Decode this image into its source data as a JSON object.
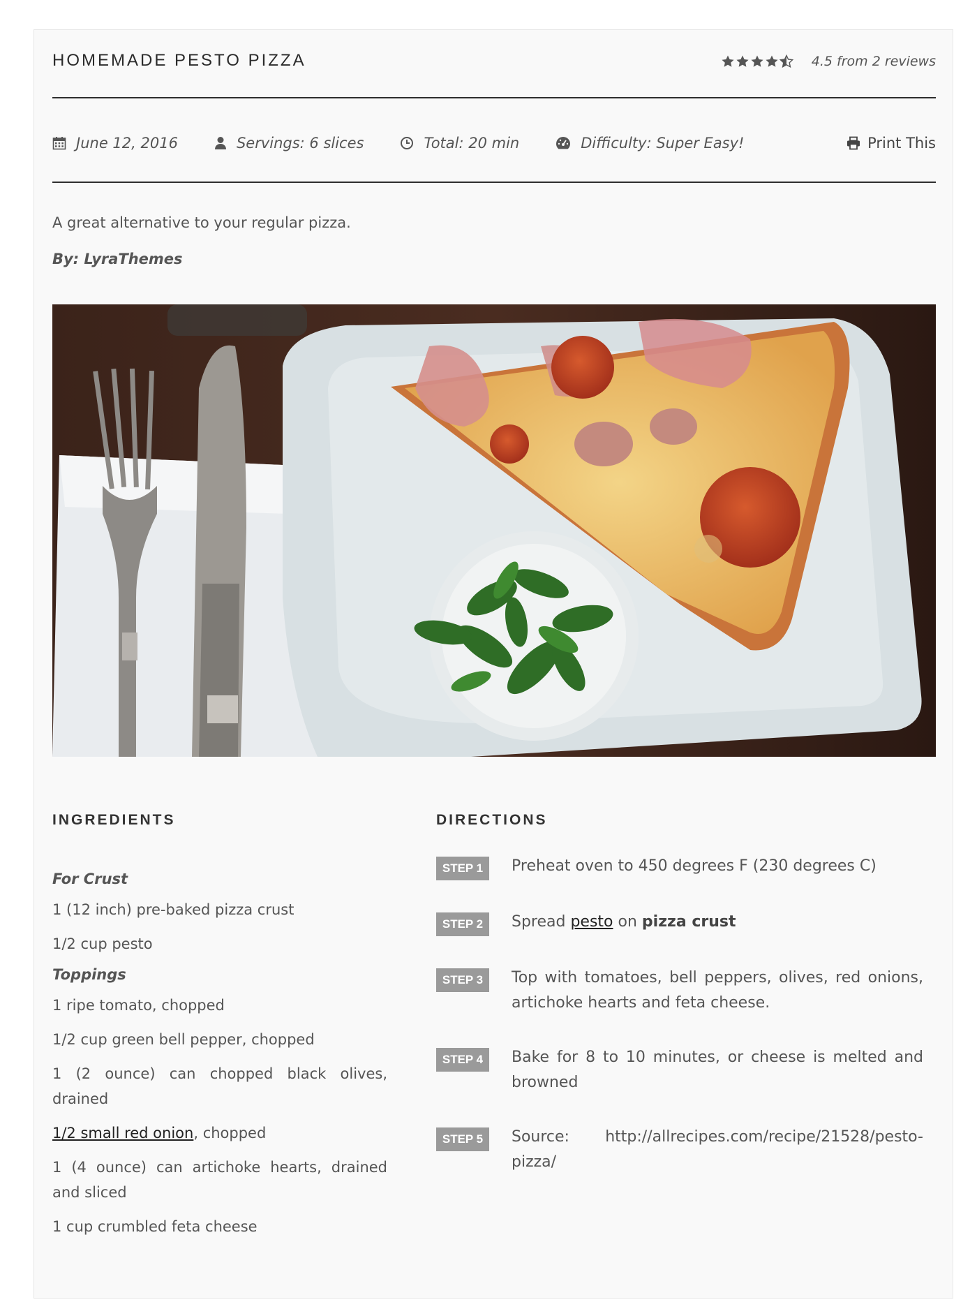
{
  "recipe": {
    "title": "HOMEMADE PESTO PIZZA",
    "rating": {
      "value": 4.5,
      "max": 5,
      "text": "4.5 from 2 reviews"
    },
    "meta": {
      "date": "June 12, 2016",
      "servings": "Servings: 6 slices",
      "total": "Total: 20 min",
      "difficulty": "Difficulty: Super Easy!"
    },
    "print_label": "Print This",
    "description": "A great alternative to your regular pizza.",
    "author": "By: LyraThemes"
  },
  "ingredients": {
    "title": "INGREDIENTS",
    "group_crust": "For Crust",
    "crust": [
      "1 (12 inch) pre-baked pizza crust",
      "1/2 cup pesto"
    ],
    "group_toppings": "Toppings",
    "toppings": [
      "1 ripe tomato, chopped",
      "1/2 cup green bell pepper, chopped",
      "1 (2 ounce) can chopped black olives, drained"
    ],
    "onion_link": "1/2 small red onion",
    "onion_rest": ", chopped",
    "toppings2": [
      "1 (4 ounce) can artichoke hearts, drained and sliced",
      "1 cup crumbled feta cheese"
    ]
  },
  "directions": {
    "title": "DIRECTIONS",
    "steps": [
      {
        "badge": "STEP 1",
        "text": "Preheat oven to 450 degrees F (230 degrees C)"
      },
      {
        "badge": "STEP 2",
        "pre": "Spread ",
        "link": "pesto",
        "mid": " on ",
        "bold": "pizza crust"
      },
      {
        "badge": "STEP 3",
        "text": "Top with tomatoes, bell peppers, olives, red onions, artichoke hearts and feta cheese."
      },
      {
        "badge": "STEP 4",
        "text": "Bake for 8 to 10 minutes, or cheese is melted and browned"
      },
      {
        "badge": "STEP 5",
        "text": "Source: http://allrecipes.com/recipe/21528/pesto-pizza/"
      }
    ]
  },
  "icons": {
    "star": "star-icon",
    "calendar": "calendar-icon",
    "user": "user-icon",
    "clock": "clock-icon",
    "gauge": "gauge-icon",
    "print": "print-icon"
  },
  "colors": {
    "accent_text": "#2b2b2b",
    "badge": "#9a9a9a",
    "background": "#f9f9f9"
  }
}
